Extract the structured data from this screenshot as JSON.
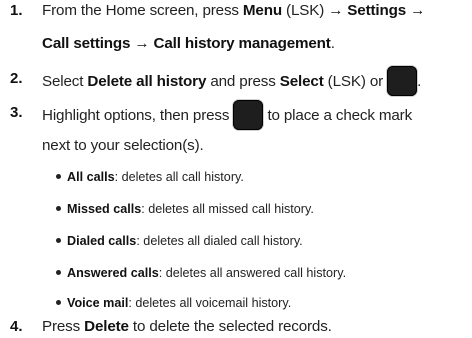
{
  "steps": [
    {
      "number": "1.",
      "line1": {
        "pre": "From the Home screen, press ",
        "menu": "Menu",
        "lsk": " (LSK) ",
        "arrow1": "→",
        "settings": " Settings ",
        "arrow2": "→"
      },
      "line2": {
        "call_settings": "Call settings",
        "arrow": " → ",
        "call_history_mgmt": "Call history management",
        "end": "."
      }
    },
    {
      "number": "2.",
      "pre": "Select ",
      "delete_all": "Delete all history",
      "mid": " and press ",
      "select": "Select",
      "post": " (LSK) or ",
      "end": "."
    },
    {
      "number": "3.",
      "pre": "Highlight options, then press ",
      "post": " to place a check mark",
      "line2": "next to your selection(s)."
    },
    {
      "number": "4.",
      "pre": "Press ",
      "delete": "Delete",
      "post": " to delete the selected records."
    }
  ],
  "options": [
    {
      "term": "All calls",
      "desc": ": deletes all call history."
    },
    {
      "term": "Missed calls",
      "desc": ": deletes all missed call history."
    },
    {
      "term": "Dialed calls",
      "desc": ": deletes all dialed call history."
    },
    {
      "term": "Answered calls",
      "desc": ": deletes all answered call history."
    },
    {
      "term": "Voice mail",
      "desc": ": deletes all voicemail history."
    }
  ],
  "icons": {
    "select_key": "ok-key-icon"
  }
}
